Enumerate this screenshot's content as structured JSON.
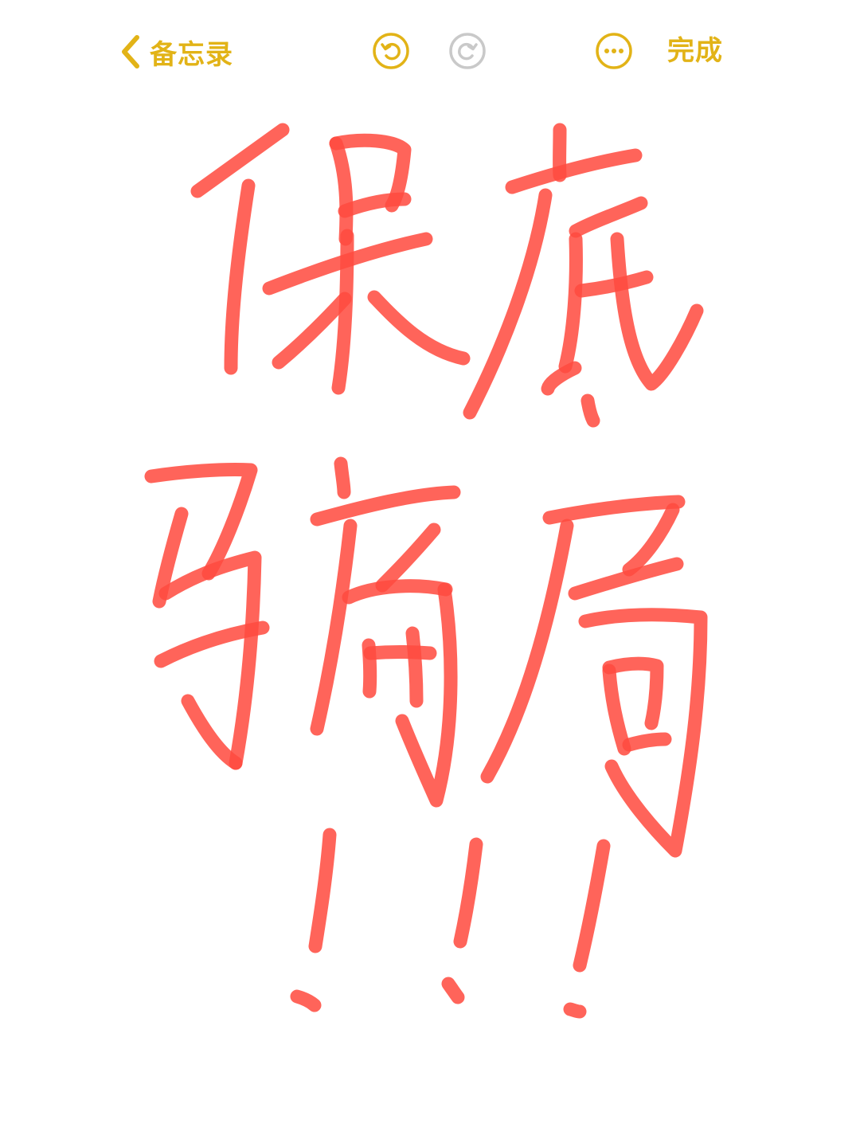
{
  "toolbar": {
    "back_label": "备忘录",
    "done_label": "完成",
    "icons": {
      "back": "chevron-left-icon",
      "undo": "undo-icon",
      "redo": "redo-icon",
      "more": "ellipsis-circle-icon"
    },
    "accent_color": "#E2B317",
    "disabled_color": "#C9C9C9"
  },
  "canvas": {
    "ink_color": "#FF4A3F",
    "handwritten_text": "保底骗局!!!"
  }
}
